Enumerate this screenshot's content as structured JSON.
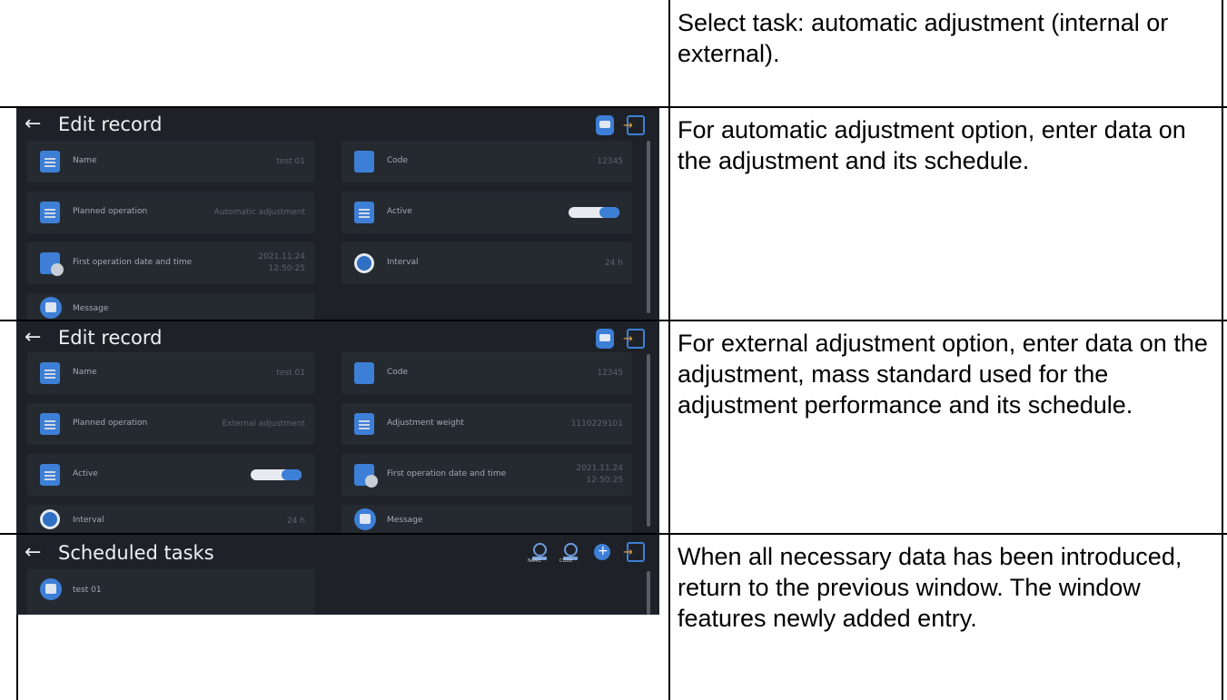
{
  "rows": [
    {
      "description": "Select task: automatic adjustment (internal or external)."
    },
    {
      "description": "For automatic adjustment option, enter data on the adjustment and its schedule."
    },
    {
      "description": "For external adjustment option, enter data on the adjustment, mass standard used for the adjustment performance and its schedule."
    },
    {
      "description": "When all necessary data has been introduced, return to the previous window. The window features newly added entry."
    }
  ],
  "screen_auto": {
    "back_arrow": "←",
    "title": "Edit record",
    "fields": {
      "name_label": "Name",
      "name_value": "test 01",
      "code_label": "Code",
      "code_value": "12345",
      "planned_label": "Planned operation",
      "planned_value": "Automatic adjustment",
      "active_label": "Active",
      "first_label": "First operation date and time",
      "first_value_date": "2021.11.24",
      "first_value_time": "12:50:25",
      "interval_label": "Interval",
      "interval_value": "24 h",
      "message_label": "Message"
    },
    "active": true
  },
  "screen_ext": {
    "back_arrow": "←",
    "title": "Edit record",
    "fields": {
      "name_label": "Name",
      "name_value": "test 01",
      "code_label": "Code",
      "code_value": "12345",
      "planned_label": "Planned operation",
      "planned_value": "External adjustment",
      "weight_label": "Adjustment weight",
      "weight_value": "1110229101",
      "active_label": "Active",
      "first_label": "First operation date and time",
      "first_value_date": "2021.11.24",
      "first_value_time": "12:50:25",
      "interval_label": "Interval",
      "interval_value": "24 h",
      "message_label": "Message"
    },
    "active": true
  },
  "screen_tasks": {
    "back_arrow": "←",
    "title": "Scheduled tasks",
    "header_icons": [
      "search-name-icon",
      "search-code-icon",
      "add-icon",
      "exit-icon"
    ],
    "search_name_caption": "NAME",
    "search_code_caption": "CODE",
    "items": [
      {
        "label": "test 01"
      }
    ]
  },
  "colors": {
    "screen_bg": "#1e2228",
    "tile_bg": "#252a31",
    "accent": "#3d7fd6"
  }
}
